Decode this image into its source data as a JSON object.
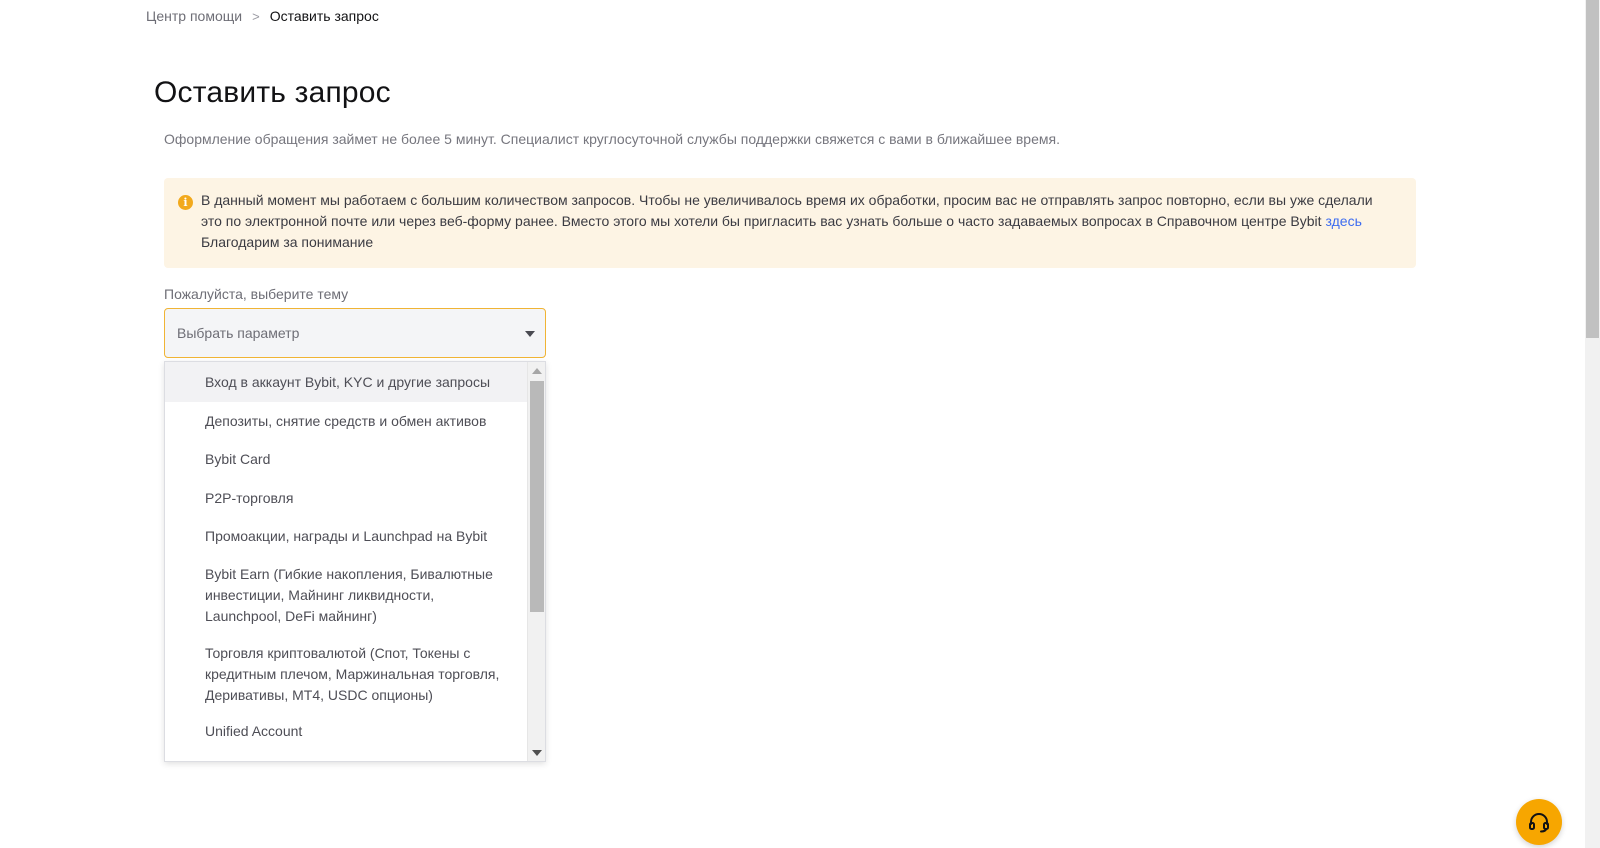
{
  "breadcrumb": {
    "home": "Центр помощи",
    "separator": ">",
    "current": "Оставить запрос"
  },
  "page": {
    "title": "Оставить запрос",
    "subtitle": "Оформление обращения займет не более 5 минут. Специалист круглосуточной службы поддержки свяжется с вами в ближайшее время."
  },
  "notice": {
    "icon": "info-icon",
    "text": "В данный момент мы работаем с большим количеством запросов. Чтобы не увеличивалось время их обработки, просим вас не отправлять запрос повторно, если вы уже сделали это по электронной почте или через веб-форму ранее. Вместо этого мы хотели бы пригласить вас узнать больше о часто задаваемых вопросах в Справочном центре Bybit",
    "link": "здесь",
    "thanks": "Благодарим за понимание",
    "background": "#fdf4e4",
    "icon_color": "#f2a91c"
  },
  "form": {
    "label": "Пожалуйста, выберите тему",
    "select_placeholder": "Выбрать параметр",
    "options": [
      "Вход в аккаунт Bybit, KYC и другие запросы",
      "Депозиты, снятие средств и обмен активов",
      "Bybit Card",
      "P2P-торговля",
      "Промоакции, награды и Launchpad на Bybit",
      "Bybit Earn (Гибкие накопления, Бивалютные инвестиции, Майнинг ликвидности, Launchpool, DeFi майнинг)",
      "Торговля криптовалютой (Спот, Токены с кредитным плечом, Маржинальная торговля, Деривативы, MT4, USDC опционы)",
      "Unified Account"
    ],
    "highlighted_index": 0
  },
  "support": {
    "icon": "headset-icon",
    "color": "#f7a600"
  }
}
